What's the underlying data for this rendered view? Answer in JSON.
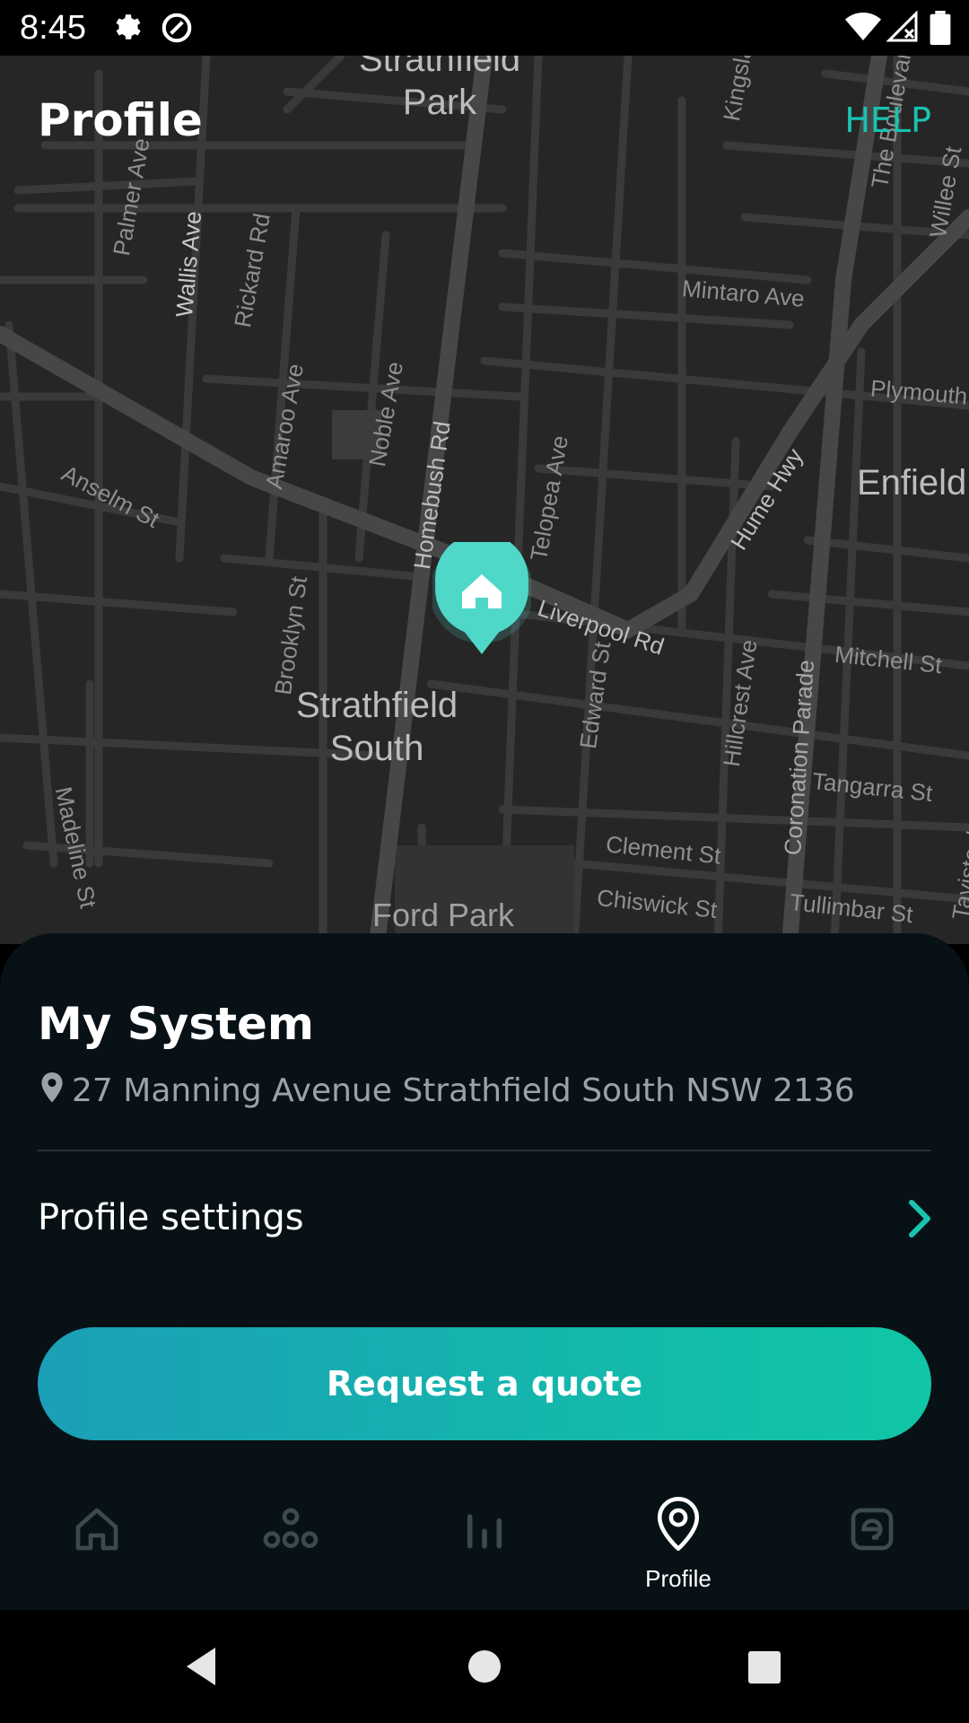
{
  "status_bar": {
    "time": "8:45",
    "icons": [
      "gear-icon",
      "data-saver-icon",
      "wifi-icon",
      "signal-icon",
      "battery-icon"
    ]
  },
  "header": {
    "title": "Profile",
    "help_label": "HELP",
    "help_color": "#19c3b0"
  },
  "map": {
    "labels": {
      "strathfield_park": "Strathfield\nPark",
      "kingsland_rd": "Kingsland Rd",
      "the_boulevard": "The Boulevard",
      "willee_st": "Willee St",
      "palmer_ave": "Palmer Ave",
      "wallis_ave": "Wallis Ave",
      "rickard_rd": "Rickard Rd",
      "mintaro_ave": "Mintaro Ave",
      "plymouth": "Plymouth",
      "amaroo_ave": "Amaroo Ave",
      "noble_ave": "Noble Ave",
      "anselm_st": "Anselm St",
      "homebush_rd": "Homebush Rd",
      "telopea_ave": "Telopea Ave",
      "hume_hwy": "Hume Hwy",
      "enfield": "Enfield",
      "liverpool_rd": "Liverpool Rd",
      "brooklyn_st": "Brooklyn St",
      "edward_st": "Edward St",
      "hillcrest_ave": "Hillcrest Ave",
      "coronation_parade": "Coronation Parade",
      "mitchell_st": "Mitchell St",
      "strathfield_south": "Strathfield\nSouth",
      "tangarra_st": "Tangarra St",
      "madeline_st": "Madeline St",
      "clement_st": "Clement St",
      "tavistock": "Tavistock",
      "chiswick_st": "Chiswick St",
      "tullimbar_st": "Tullimbar St",
      "ford_park": "Ford Park"
    },
    "pin_icon": "home-pin-icon",
    "accent": "#4fd8c8"
  },
  "system": {
    "title": "My System",
    "address_icon": "location-pin-icon",
    "address": "27 Manning Avenue Strathfield South NSW 2136"
  },
  "settings": {
    "label": "Profile settings",
    "chevron_color": "#19c3b0"
  },
  "quote_button": {
    "label": "Request a quote"
  },
  "bottom_nav": {
    "items": [
      {
        "icon": "home-icon",
        "label": ""
      },
      {
        "icon": "system-nodes-icon",
        "label": ""
      },
      {
        "icon": "bar-chart-icon",
        "label": ""
      },
      {
        "icon": "location-pin-icon",
        "label": "Profile",
        "active": true
      },
      {
        "icon": "energy-e-icon",
        "label": ""
      }
    ],
    "inactive_color": "#3a4a50",
    "active_color": "#ffffff"
  },
  "system_nav": {
    "icons": [
      "back-icon",
      "home-circle-icon",
      "recents-icon"
    ]
  }
}
